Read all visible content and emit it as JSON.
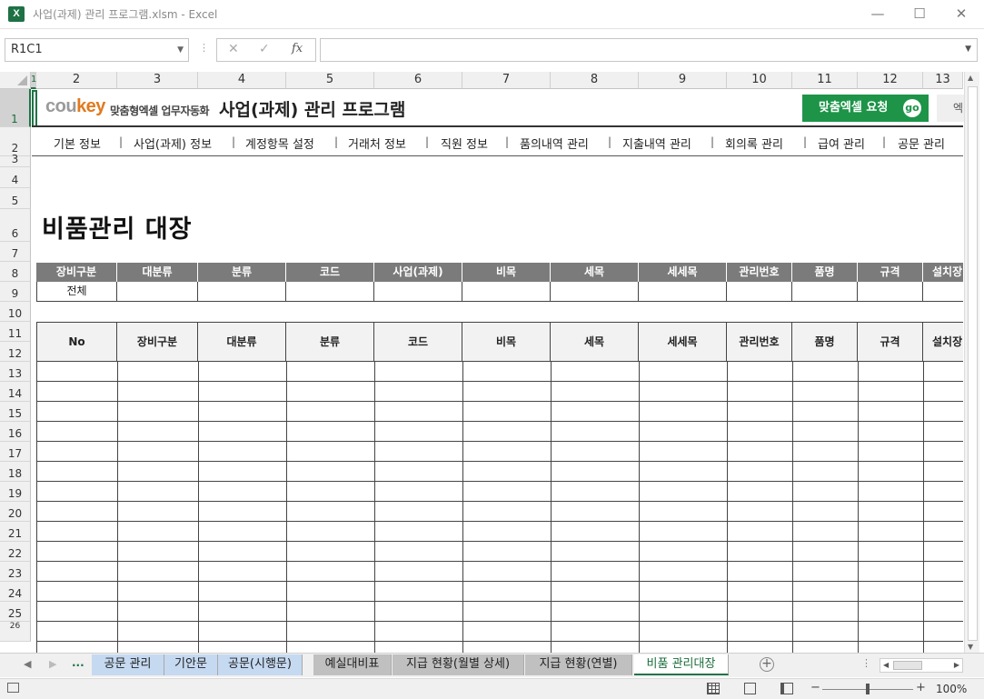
{
  "window": {
    "app_icon": "X",
    "title": "사업(과제) 관리 프로그램.xlsm - Excel",
    "minimize": "—",
    "maximize": "☐",
    "close": "✕"
  },
  "formula_bar": {
    "name_box": "R1C1",
    "cancel": "✕",
    "enter": "✓",
    "fx": "fx",
    "value": ""
  },
  "column_headers": [
    "1",
    "2",
    "3",
    "4",
    "5",
    "6",
    "7",
    "8",
    "9",
    "10",
    "11",
    "12",
    "13"
  ],
  "row_headers": [
    "1",
    "2",
    "3",
    "4",
    "5",
    "6",
    "7",
    "8",
    "9",
    "10",
    "11",
    "12",
    "13",
    "14",
    "15",
    "16",
    "17",
    "18",
    "19",
    "20",
    "21",
    "22",
    "23",
    "24",
    "25",
    "26"
  ],
  "banner": {
    "logo_main": "cou",
    "logo_accent": "key",
    "logo_sub": "맞춤형엑셀 업무자동화",
    "program_title": "사업(과제) 관리 프로그램",
    "request_button": "맞춤엑셀 요청",
    "go_badge": "go",
    "second_button": "엑"
  },
  "nav_menu": [
    "기본 정보",
    "사업(과제) 정보",
    "계정항목 설정",
    "거래처 정보",
    "직원 정보",
    "품의내역 관리",
    "지출내역 관리",
    "회의록 관리",
    "급여 관리",
    "공문 관리"
  ],
  "nav_separator": "|",
  "page_heading": "비품관리 대장",
  "filter_table": {
    "headers": [
      "장비구분",
      "대분류",
      "분류",
      "코드",
      "사업(과제)",
      "비목",
      "세목",
      "세세목",
      "관리번호",
      "품명",
      "규격",
      "설치장"
    ],
    "values": [
      "전체",
      "",
      "",
      "",
      "",
      "",
      "",
      "",
      "",
      "",
      "",
      ""
    ]
  },
  "main_table": {
    "headers": [
      "No",
      "장비구분",
      "대분류",
      "분류",
      "코드",
      "비목",
      "세목",
      "세세목",
      "관리번호",
      "품명",
      "규격",
      "설치장"
    ]
  },
  "sheet_tabs": {
    "nav_prev": "◀",
    "nav_next": "▶",
    "ellipsis": "...",
    "tabs": [
      {
        "label": "공문 관리",
        "color": "#c5d9f1"
      },
      {
        "label": "기안문",
        "color": "#c5d9f1"
      },
      {
        "label": "공문(시행문)",
        "color": "#c5d9f1"
      },
      {
        "label": "예실대비표",
        "color": "#c0c0c0"
      },
      {
        "label": "지급 현황(월별 상세)",
        "color": "#c0c0c0"
      },
      {
        "label": "지급 현황(연별)",
        "color": "#c0c0c0"
      },
      {
        "label": "비품 관리대장",
        "color": "#ffffff",
        "active": true
      }
    ],
    "add_sheet": "+"
  },
  "status_bar": {
    "zoom_minus": "−",
    "zoom_plus": "+",
    "zoom_level": "100%"
  },
  "colors": {
    "excel_green": "#217346",
    "request_green": "#1d9448",
    "header_gray": "#7b7b7b",
    "logo_orange": "#e07a1e"
  }
}
